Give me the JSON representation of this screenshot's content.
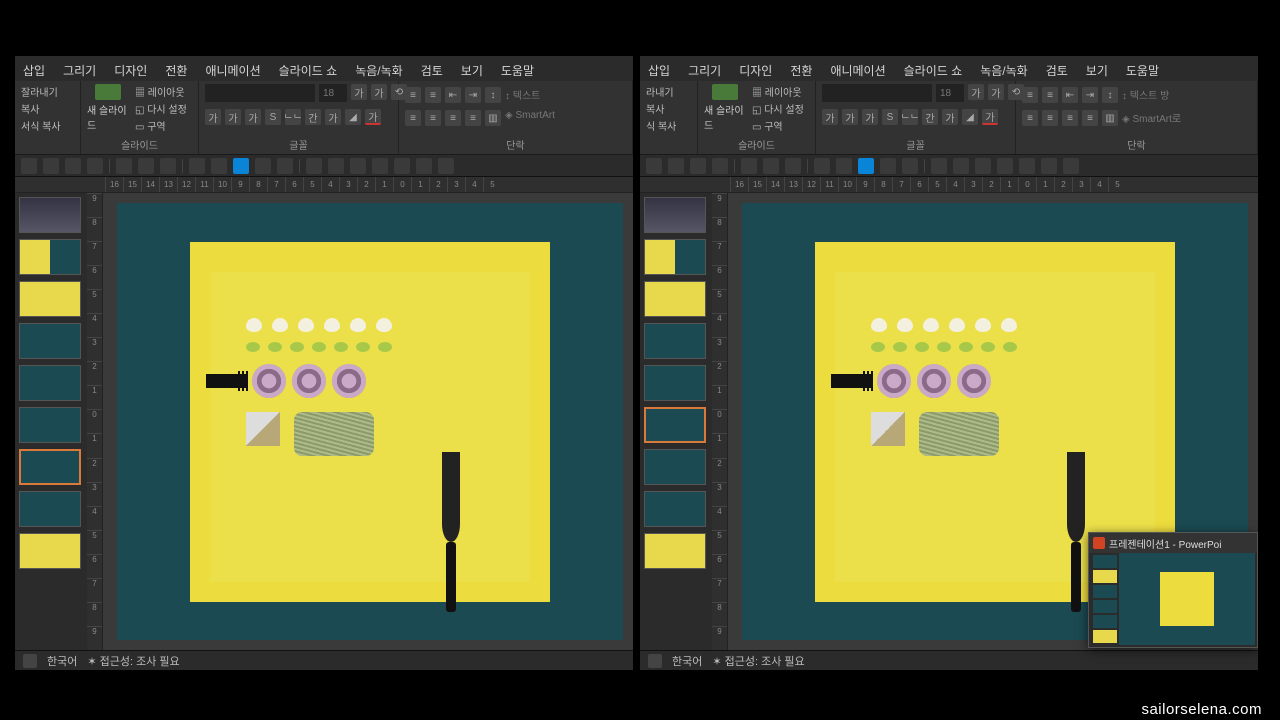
{
  "tabs": [
    "삽입",
    "그리기",
    "디자인",
    "전환",
    "애니메이션",
    "슬라이드 쇼",
    "녹음/녹화",
    "검토",
    "보기",
    "도움말"
  ],
  "clipboard": {
    "cut": "잘라내기",
    "copy": "복사",
    "paste": "서식 복사"
  },
  "slides_group": {
    "new_slide": "새 슬라이드",
    "layout": "레이아웃",
    "reset": "다시 설정",
    "section": "구역",
    "label": "슬라이드"
  },
  "font_group": {
    "size": "18",
    "label": "글꼴",
    "buttons": [
      "가",
      "가",
      "가",
      "S",
      "ᄒᄂᄂ",
      "간나",
      "가가"
    ],
    "fx": [
      "가",
      "가"
    ]
  },
  "para_group": {
    "label": "단락",
    "text_dir": "텍스트",
    "text_align": "텍스트 맞",
    "smartart": "SmartArt"
  },
  "ruler_h": [
    "16",
    "15",
    "14",
    "13",
    "12",
    "11",
    "10",
    "9",
    "8",
    "7",
    "6",
    "5",
    "4",
    "3",
    "2",
    "1",
    "0",
    "1",
    "2",
    "3",
    "4",
    "5"
  ],
  "ruler_v": [
    "9",
    "8",
    "7",
    "6",
    "5",
    "4",
    "3",
    "2",
    "1",
    "0",
    "1",
    "2",
    "3",
    "4",
    "5",
    "6",
    "7",
    "8",
    "9"
  ],
  "status": {
    "lang": "한국어",
    "access": "접근성: 조사 필요"
  },
  "preview": {
    "title": "프레젠테이션1 - PowerPoi"
  },
  "watermark": "sailorselena.com"
}
